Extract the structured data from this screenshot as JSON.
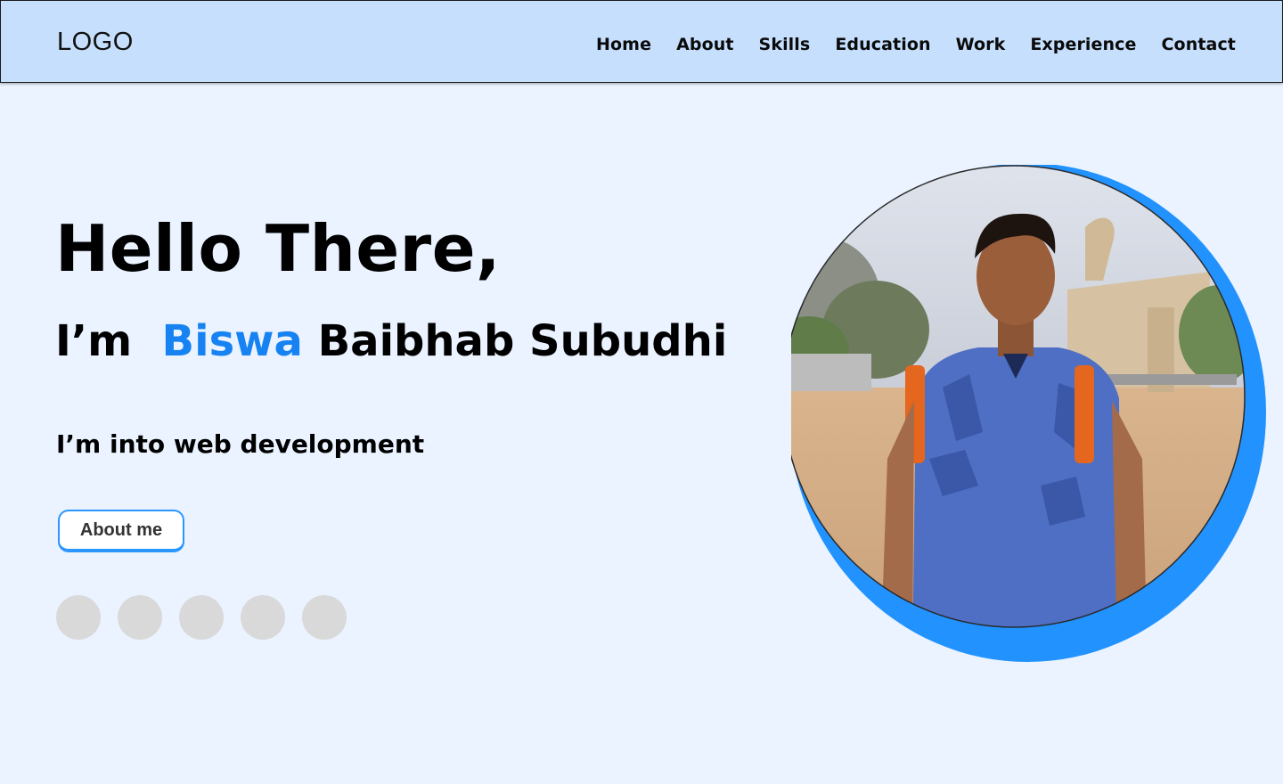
{
  "header": {
    "logo": "LOGO",
    "nav": [
      "Home",
      "About",
      "Skills",
      "Education",
      "Work",
      "Experience",
      "Contact"
    ]
  },
  "hero": {
    "greeting": "Hello There,",
    "intro_prefix": "I’m",
    "first_name": "Biswa",
    "last_name": "Baibhab Subudhi",
    "tagline": "I’m into web development",
    "cta_label": "About me"
  },
  "socials": [
    "social-link-1",
    "social-link-2",
    "social-link-3",
    "social-link-4",
    "social-link-5"
  ],
  "colors": {
    "header_bg": "#c5dffc",
    "page_bg": "#eaf3ff",
    "accent": "#1783f2",
    "ring": "#2292ff",
    "social_placeholder": "#d9d9d9"
  }
}
